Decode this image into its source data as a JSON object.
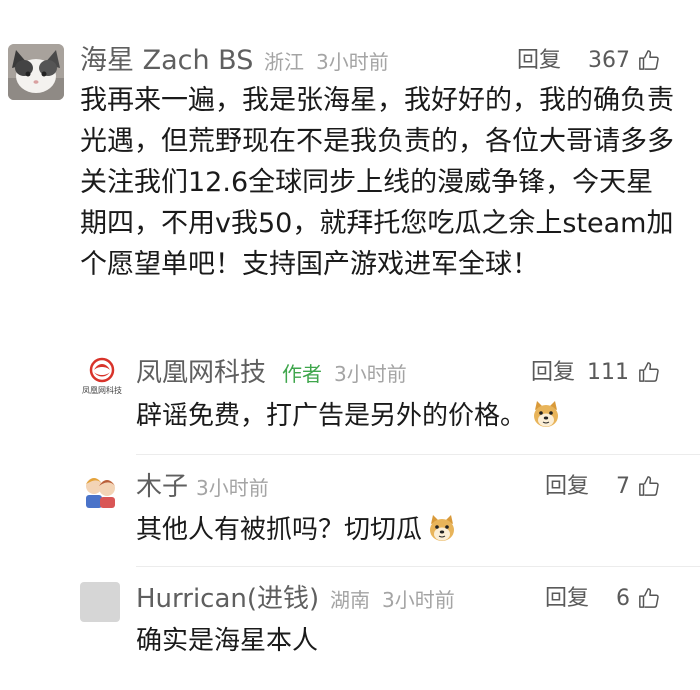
{
  "comments": [
    {
      "author": "海星 Zach BS",
      "location": "浙江",
      "time": "3小时前",
      "reply_label": "回复",
      "likes": "367",
      "text": "我再来一遍，我是张海星，我好好的，我的确负责光遇，但荒野现在不是我负责的，各位大哥请多多关注我们12.6全球同步上线的漫威争锋，今天星期四，不用v我50，就拜托您吃瓜之余上steam加个愿望单吧！支持国产游戏进军全球！",
      "avatar_icon": "cat-avatar-icon"
    }
  ],
  "replies": [
    {
      "author": "凤凰网科技",
      "author_tag": "作者",
      "time": "3小时前",
      "reply_label": "回复",
      "likes": "111",
      "text": "辟谣免费，打广告是另外的价格。",
      "avatar_icon": "phoenix-logo-icon",
      "avatar_caption": "凤凰网科技",
      "emoji_icon": "doge-emoji-icon"
    },
    {
      "author": "木子",
      "time": "3小时前",
      "reply_label": "回复",
      "likes": "7",
      "text": "其他人有被抓吗？切切瓜",
      "avatar_icon": "anime-avatar-icon",
      "emoji_icon": "doge-emoji-icon"
    },
    {
      "author": "Hurrican(进钱)",
      "location": "湖南",
      "time": "3小时前",
      "reply_label": "回复",
      "likes": "6",
      "text": "确实是海星本人",
      "avatar_icon": "blank-avatar-icon"
    }
  ],
  "colors": {
    "author_tag": "#3fa64c",
    "meta": "#a4a4a4",
    "name": "#5f5f5f"
  }
}
